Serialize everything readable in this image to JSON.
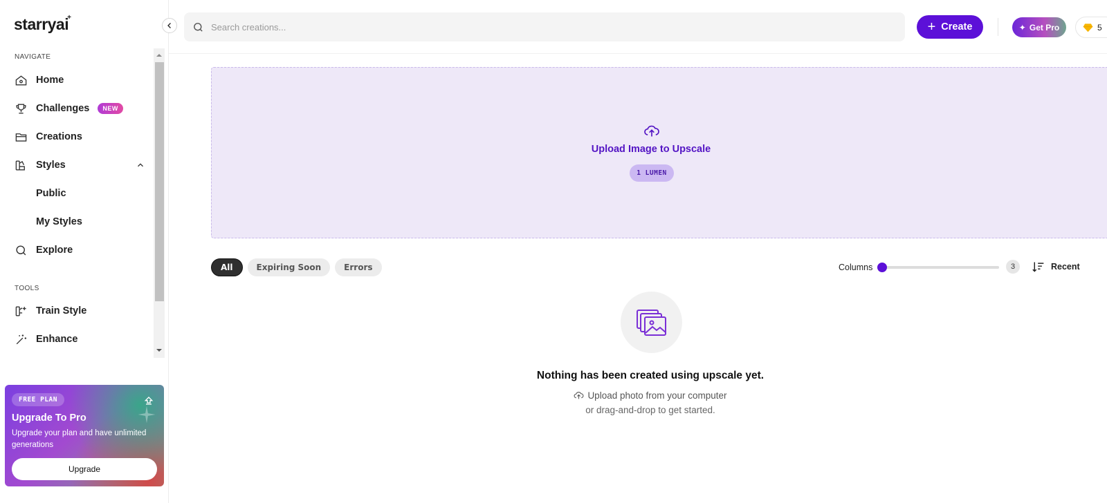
{
  "brand": {
    "logo_text": "starryai",
    "logo_mark": "+"
  },
  "sidebar": {
    "navigate_label": "NAVIGATE",
    "tools_label": "TOOLS",
    "items": [
      {
        "label": "Home",
        "icon": "home-icon"
      },
      {
        "label": "Challenges",
        "icon": "trophy-icon",
        "badge": "NEW"
      },
      {
        "label": "Creations",
        "icon": "folder-icon"
      },
      {
        "label": "Styles",
        "icon": "styles-icon"
      },
      {
        "label": "Public"
      },
      {
        "label": "My Styles"
      },
      {
        "label": "Explore",
        "icon": "search-icon"
      }
    ],
    "tools": [
      {
        "label": "Train Style",
        "icon": "train-style-icon"
      },
      {
        "label": "Enhance",
        "icon": "magic-wand-icon"
      }
    ],
    "upgrade_card": {
      "plan_badge": "FREE PLAN",
      "title": "Upgrade To Pro",
      "text": "Upgrade your plan and have unlimited generations",
      "button": "Upgrade"
    }
  },
  "header": {
    "search_placeholder": "Search creations...",
    "create_label": "Create",
    "get_pro_label": "Get Pro",
    "lumens": "5"
  },
  "upload": {
    "title": "Upload Image to Upscale",
    "cost": "1 LUMEN"
  },
  "filters": {
    "chips": [
      "All",
      "Expiring Soon",
      "Errors"
    ],
    "active": "All"
  },
  "columns": {
    "label": "Columns",
    "value": "3"
  },
  "sort": {
    "label": "Recent"
  },
  "empty_state": {
    "title": "Nothing has been created using upscale yet.",
    "line1": "Upload photo from your computer",
    "line2": "or drag-and-drop to get started."
  },
  "colors": {
    "accent": "#5c10d8",
    "upload_bg": "#eee8f8"
  }
}
